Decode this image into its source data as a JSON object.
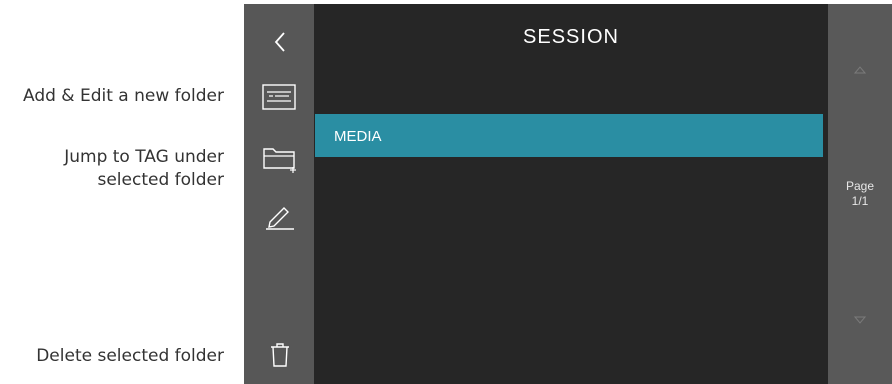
{
  "annotations": {
    "add_edit": "Add & Edit a new folder",
    "jump_line1": "Jump to TAG under",
    "jump_line2": "selected folder",
    "delete": "Delete selected folder"
  },
  "screen": {
    "title": "SESSION",
    "folders": [
      {
        "label": "MEDIA",
        "selected": true
      }
    ],
    "page_label": "Page",
    "page_value": "1/1"
  },
  "toolbar": {
    "icons": [
      "back-arrow-icon",
      "keyboard-icon",
      "new-folder-icon",
      "edit-pencil-icon",
      "trash-icon"
    ]
  },
  "colors": {
    "selected_row": "#2a8ea3",
    "sidebar": "#575757",
    "main_background": "#262626"
  }
}
